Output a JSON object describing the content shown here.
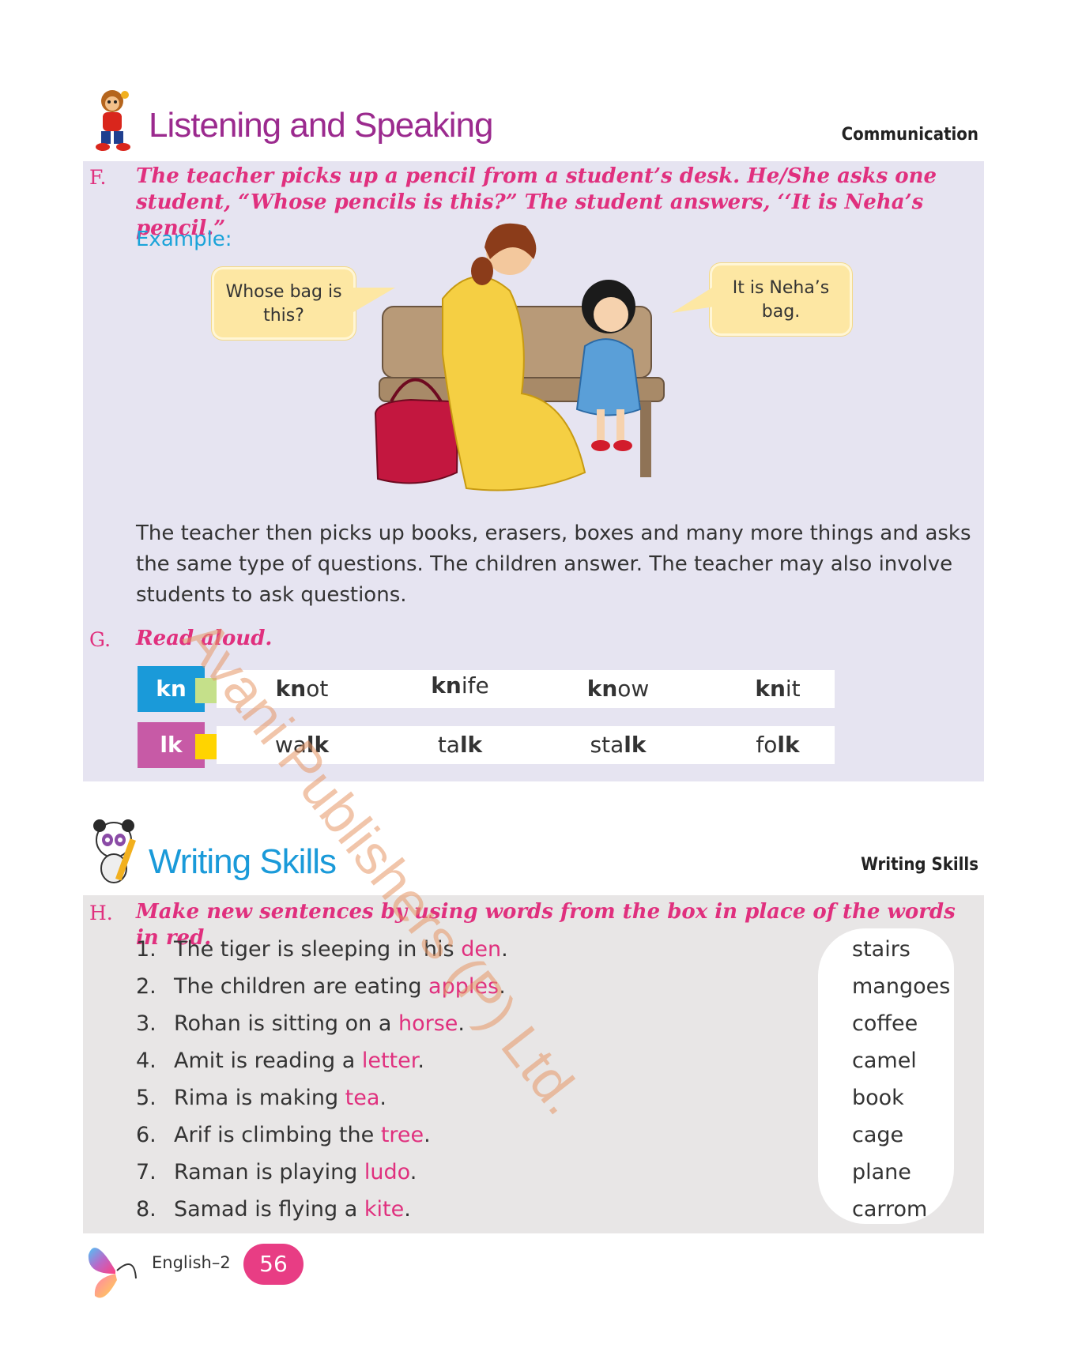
{
  "listening": {
    "title": "Listening and Speaking",
    "tag": "Communication",
    "question_letter": "F.",
    "question_text": "The teacher picks up a pencil from a student’s desk. He/She asks one student, “Whose pencils is this?” The student answers, ‘‘It is Neha’s  pencil.”",
    "example_label": "Example:",
    "bubble_left": "Whose bag is this?",
    "bubble_right": "It is Neha’s bag.",
    "paragraph": "The teacher then picks up books, erasers, boxes and many more things and asks the same type of questions. The children answer. The teacher may also involve students to ask questions."
  },
  "read_aloud": {
    "question_letter": "G.",
    "question_text": "Read aloud.",
    "rows": [
      {
        "tag": "kn",
        "tag_color": "#1a9ad9",
        "square_color": "#c5e08a",
        "words": [
          {
            "bold": "kn",
            "rest": "ot",
            "bold_first": true
          },
          {
            "bold": "kn",
            "rest": "ife",
            "bold_first": true
          },
          {
            "bold": "kn",
            "rest": "ow",
            "bold_first": true
          },
          {
            "bold": "kn",
            "rest": "it",
            "bold_first": true
          }
        ]
      },
      {
        "tag": "lk",
        "tag_color": "#c75aa6",
        "square_color": "#ffd400",
        "words": [
          {
            "rest": "wa",
            "bold": "lk",
            "bold_first": false
          },
          {
            "rest": "ta",
            "bold": "lk",
            "bold_first": false
          },
          {
            "rest": "sta",
            "bold": "lk",
            "bold_first": false
          },
          {
            "rest": "fo",
            "bold": "lk",
            "bold_first": false
          }
        ]
      }
    ]
  },
  "writing": {
    "title": "Writing Skills",
    "tag": "Writing Skills",
    "question_letter": "H.",
    "question_text": "Make new sentences by using words from the box in place of the words in red.",
    "items": [
      {
        "num": "1.",
        "text": "The tiger is sleeping in his ",
        "red": "den",
        "end": "."
      },
      {
        "num": "2.",
        "text": "The children are eating ",
        "red": "apples",
        "end": "."
      },
      {
        "num": "3.",
        "text": "Rohan is sitting on a ",
        "red": "horse",
        "end": "."
      },
      {
        "num": "4.",
        "text": "Amit is reading a ",
        "red": "letter",
        "end": "."
      },
      {
        "num": "5.",
        "text": "Rima is making ",
        "red": "tea",
        "end": "."
      },
      {
        "num": "6.",
        "text": "Arif is climbing the ",
        "red": "tree",
        "end": "."
      },
      {
        "num": "7.",
        "text": "Raman is playing ",
        "red": "ludo",
        "end": "."
      },
      {
        "num": "8.",
        "text": "Samad is flying a ",
        "red": "kite",
        "end": "."
      }
    ],
    "box_words": [
      "stairs",
      "mangoes",
      "coffee",
      "camel",
      "book",
      "cage",
      "plane",
      "carrom"
    ]
  },
  "footer": {
    "label": "English–2",
    "page": "56"
  },
  "watermark": "Avani Publishers (P) Ltd.",
  "colors": {
    "pink": "#e0307e",
    "purple_title": "#9b2a8e",
    "blue_title": "#1a9ad9"
  }
}
